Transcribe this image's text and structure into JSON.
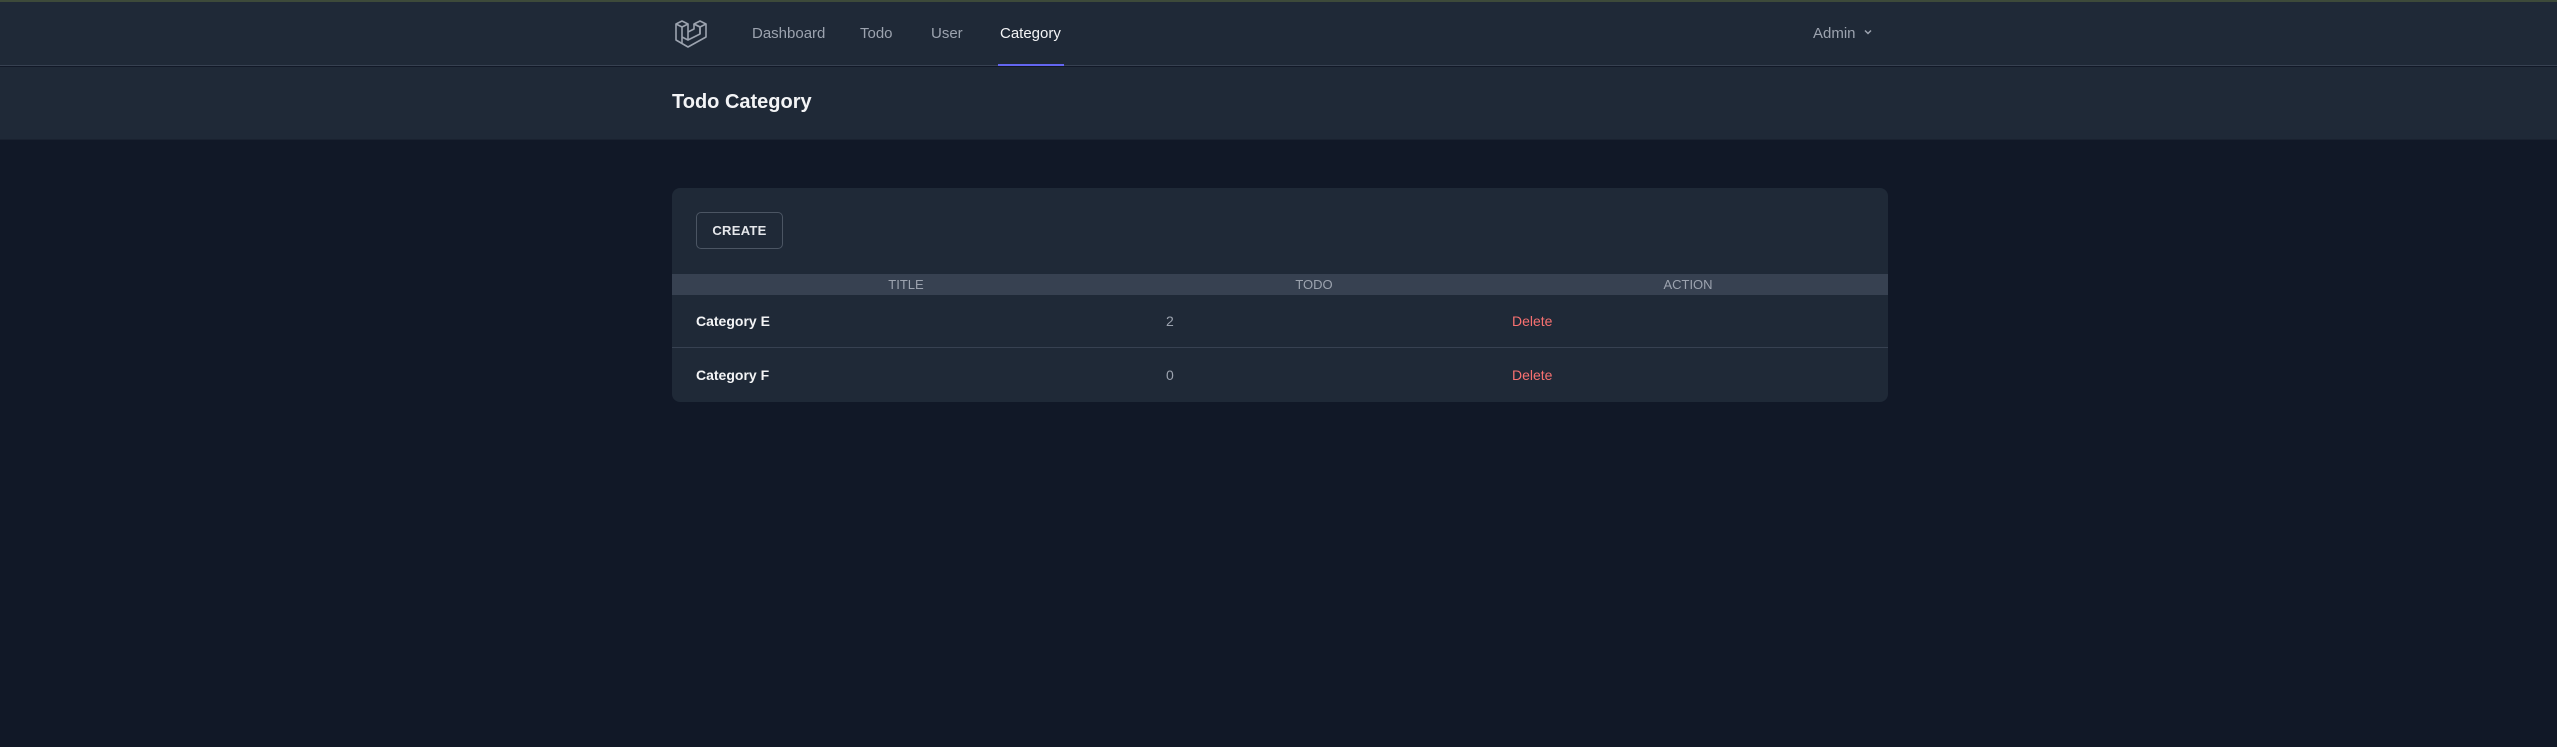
{
  "nav": {
    "logo_icon": "laravel-logo-icon",
    "links": [
      {
        "label": "Dashboard",
        "active": false
      },
      {
        "label": "Todo",
        "active": false
      },
      {
        "label": "User",
        "active": false
      },
      {
        "label": "Category",
        "active": true
      }
    ],
    "user": {
      "label": "Admin",
      "icon": "chevron-down-icon"
    }
  },
  "header": {
    "title": "Todo Category"
  },
  "toolbar": {
    "create_label": "CREATE"
  },
  "table": {
    "columns": [
      "TITLE",
      "TODO",
      "ACTION"
    ],
    "rows": [
      {
        "title": "Category E",
        "todo": "2",
        "action": "Delete"
      },
      {
        "title": "Category F",
        "todo": "0",
        "action": "Delete"
      }
    ]
  },
  "colors": {
    "background": "#111827",
    "surface": "#1f2937",
    "accent": "#6366f1",
    "danger": "#f87171"
  }
}
